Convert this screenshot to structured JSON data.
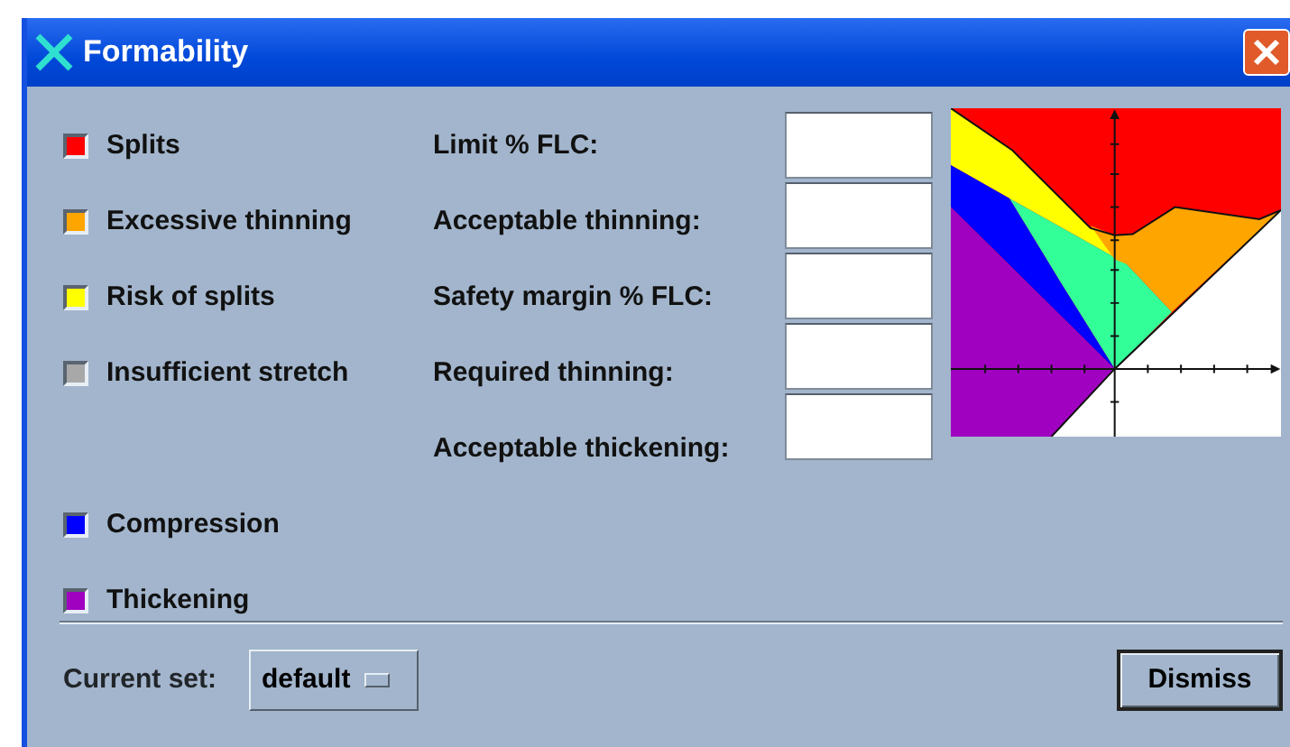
{
  "window": {
    "title": "Formability"
  },
  "legend_upper": [
    {
      "label": "Splits",
      "color": "#ff0000"
    },
    {
      "label": "Excessive thinning",
      "color": "#ffa500"
    },
    {
      "label": "Risk of splits",
      "color": "#ffff00"
    },
    {
      "label": "Insufficient stretch",
      "color": "#a8a8a8"
    }
  ],
  "legend_lower": [
    {
      "label": "Compression",
      "color": "#0000ff"
    },
    {
      "label": "Thickening",
      "color": "#a000c0"
    }
  ],
  "limits": [
    {
      "label": "Limit % FLC:"
    },
    {
      "label": "Acceptable thinning:"
    },
    {
      "label": "Safety margin % FLC:"
    },
    {
      "label": "Required thinning:"
    },
    {
      "label": "Acceptable thickening:"
    }
  ],
  "footer": {
    "set_label": "Current set:",
    "set_value": "default",
    "dismiss": "Dismiss"
  }
}
